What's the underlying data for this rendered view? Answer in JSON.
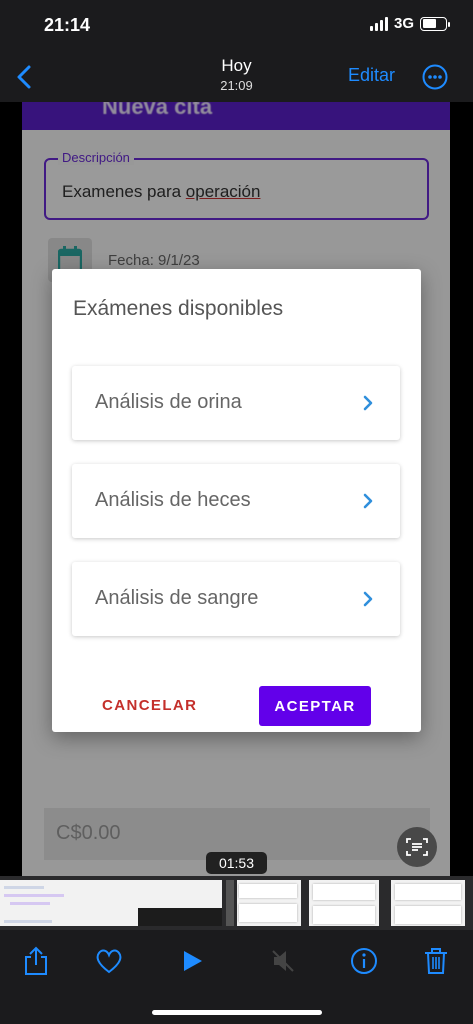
{
  "status_bar": {
    "time": "21:14",
    "network": "3G"
  },
  "nav": {
    "title": "Hoy",
    "subtitle": "21:09",
    "edit_label": "Editar"
  },
  "app": {
    "header_title": "Nueva cita",
    "description_label": "Descripción",
    "description_value_a": "Examenes para ",
    "description_value_b": "operación",
    "date_text": "Fecha: 9/1/23",
    "total_text": "C$0.00"
  },
  "dialog": {
    "title": "Exámenes disponibles",
    "options": [
      {
        "label": "Análisis de orina"
      },
      {
        "label": "Análisis de heces"
      },
      {
        "label": "Análisis de sangre"
      }
    ],
    "cancel_label": "CANCELAR",
    "accept_label": "ACEPTAR"
  },
  "video": {
    "timestamp": "01:53"
  },
  "colors": {
    "accent_ios": "#1e8bff",
    "purple": "#6200ea",
    "cancel_red": "#c4302b",
    "chevron_blue": "#2f8fdc"
  },
  "icons": [
    "back-icon",
    "more-icon",
    "calendar-icon",
    "chevron-right-icon",
    "scan-text-icon",
    "share-icon",
    "heart-icon",
    "play-icon",
    "mute-icon",
    "info-icon",
    "trash-icon"
  ]
}
